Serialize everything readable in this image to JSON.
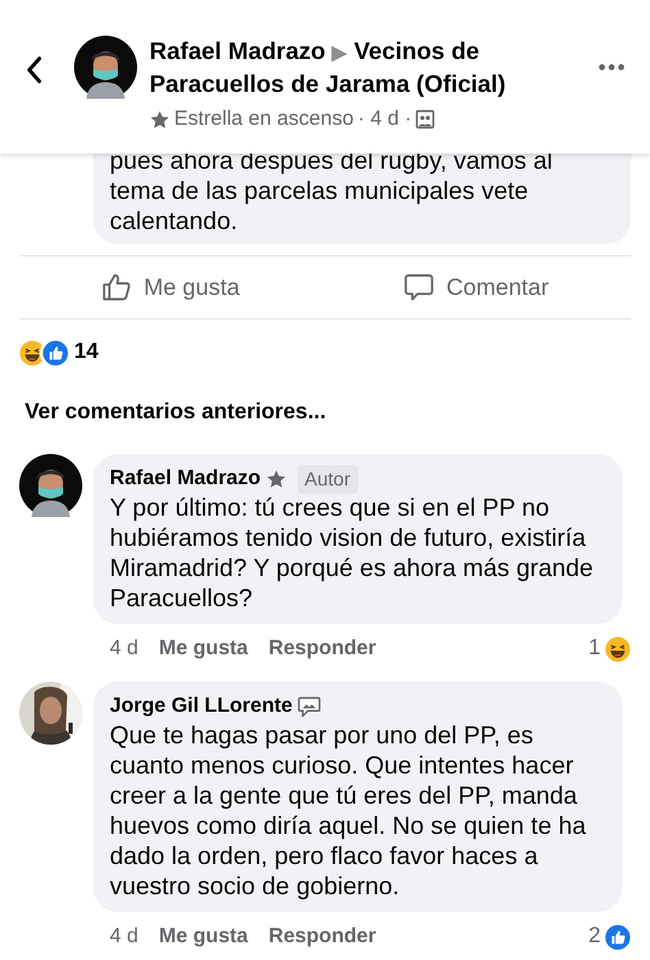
{
  "header": {
    "author": "Rafael Madrazo",
    "separator": "▶",
    "group": "Vecinos de Paracuellos de Jarama (Oficial)",
    "badge": "Estrella en ascenso",
    "time": "· 4 d ·"
  },
  "post_excerpt": "pues ahora despues del rugby,  vamos al tema de las parcelas municipales vete calentando.",
  "actions": [
    {
      "kind": "like",
      "label": "Me gusta"
    },
    {
      "kind": "comment",
      "label": "Comentar"
    }
  ],
  "reactions": {
    "icons": [
      {
        "kind": "haha"
      },
      {
        "kind": "like"
      }
    ],
    "count": "14"
  },
  "more_comments": "Ver comentarios anteriores...",
  "comments": [
    {
      "avatar": {
        "kind": "memoji"
      },
      "author": "Rafael Madrazo",
      "author_icon": {
        "kind": "star"
      },
      "tag": "Autor",
      "text": "Y por último: tú crees que si en el PP no hubiéramos tenido vision de futuro, existiría Miramadrid? Y porqué es ahora más grande Paracuellos?",
      "time": "4 d",
      "like": "Me gusta",
      "reply": "Responder",
      "reaction": {
        "count": "1",
        "kind": "haha"
      }
    },
    {
      "author": "Jorge Gil LLorente",
      "author_icon": {
        "kind": "conversation"
      },
      "text": "Que te hagas pasar por uno del PP, es cuanto menos curioso. Que intentes hacer creer a la gente que tú eres del PP, manda huevos como diría aquel. No se quien te ha dado la orden, pero flaco favor haces a vuestro socio de gobierno.",
      "time": "4 d",
      "like": "Me gusta",
      "reply": "Responder",
      "reaction": {
        "count": "2",
        "kind": "like"
      }
    }
  ]
}
